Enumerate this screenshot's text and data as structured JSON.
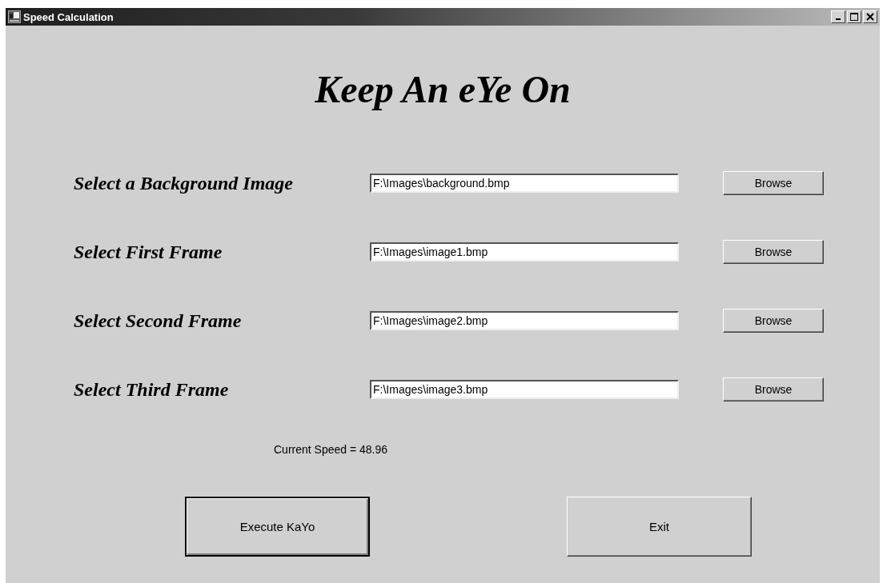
{
  "window": {
    "title": "Speed Calculation"
  },
  "heading": "Keep An eYe On",
  "rows": [
    {
      "label": "Select a Background Image",
      "value": "F:\\Images\\background.bmp",
      "button": "Browse"
    },
    {
      "label": "Select First Frame",
      "value": "F:\\Images\\image1.bmp",
      "button": "Browse"
    },
    {
      "label": "Select Second Frame",
      "value": "F:\\Images\\image2.bmp",
      "button": "Browse"
    },
    {
      "label": "Select Third Frame",
      "value": "F:\\Images\\image3.bmp",
      "button": "Browse"
    }
  ],
  "result": "Current Speed = 48.96",
  "buttons": [
    {
      "label": "Execute KaYo",
      "default": true
    },
    {
      "label": "Exit",
      "default": false
    }
  ]
}
